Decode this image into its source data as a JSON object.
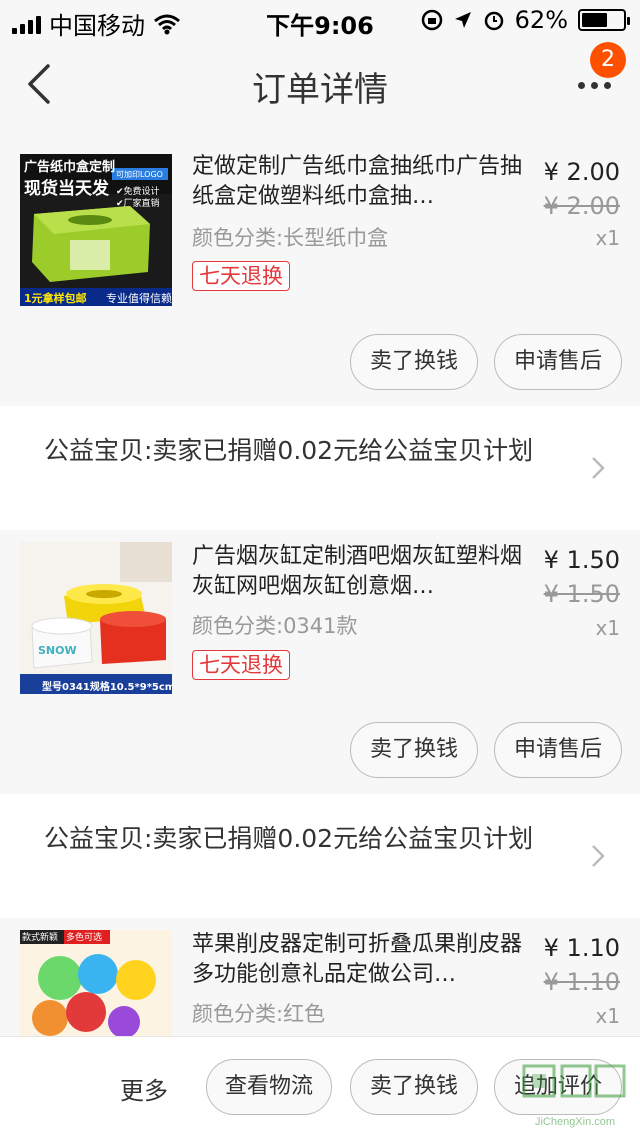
{
  "status_bar": {
    "carrier": "中国移动",
    "time": "下午9:06",
    "battery": "62%",
    "battery_level": 0.62
  },
  "nav": {
    "title": "订单详情",
    "badge": "2"
  },
  "items": [
    {
      "title": "定做定制广告纸巾盒抽纸巾广告抽纸盒定做塑料纸巾盒抽…",
      "price": "¥ 2.00",
      "orig_price": "¥ 2.00",
      "qty": "x1",
      "variant": "颜色分类:长型纸巾盒",
      "tag": "七天退换",
      "thumb_text": {
        "line1": "广告纸巾盒定制",
        "line2": "现货当天发",
        "side1": "可加印LOGO",
        "side2": "✔免费设计",
        "side3": "✔厂家直销",
        "bottom_left": "1元拿样包邮",
        "bottom_right": "专业值得信赖"
      },
      "buttons": [
        "卖了换钱",
        "申请售后"
      ]
    },
    {
      "title": "广告烟灰缸定制酒吧烟灰缸塑料烟灰缸网吧烟灰缸创意烟…",
      "price": "¥ 1.50",
      "orig_price": "¥ 1.50",
      "qty": "x1",
      "variant": "颜色分类:0341款",
      "tag": "七天退换",
      "thumb_text": {
        "bottom": "型号0341规格10.5*9*5cm",
        "brand": "SNOW"
      },
      "buttons": [
        "卖了换钱",
        "申请售后"
      ]
    },
    {
      "title": "苹果削皮器定制可折叠瓜果削皮器多功能创意礼品定做公司…",
      "price": "¥ 1.10",
      "orig_price": "¥ 1.10",
      "qty": "x1",
      "variant": "颜色分类:红色",
      "thumb_text": {
        "tag1": "款式新颖",
        "tag2": "多色可选"
      }
    }
  ],
  "donation": {
    "text": "公益宝贝:卖家已捐赠0.02元给公益宝贝计划"
  },
  "bottom_bar": {
    "more": "更多",
    "buttons": [
      "查看物流",
      "卖了换钱",
      "追加评价"
    ]
  },
  "watermark": {
    "text": "JiChengXin.com"
  },
  "colors": {
    "accent": "#ff5000",
    "tag_red": "#e4393c",
    "background": "#f2f2f2"
  }
}
